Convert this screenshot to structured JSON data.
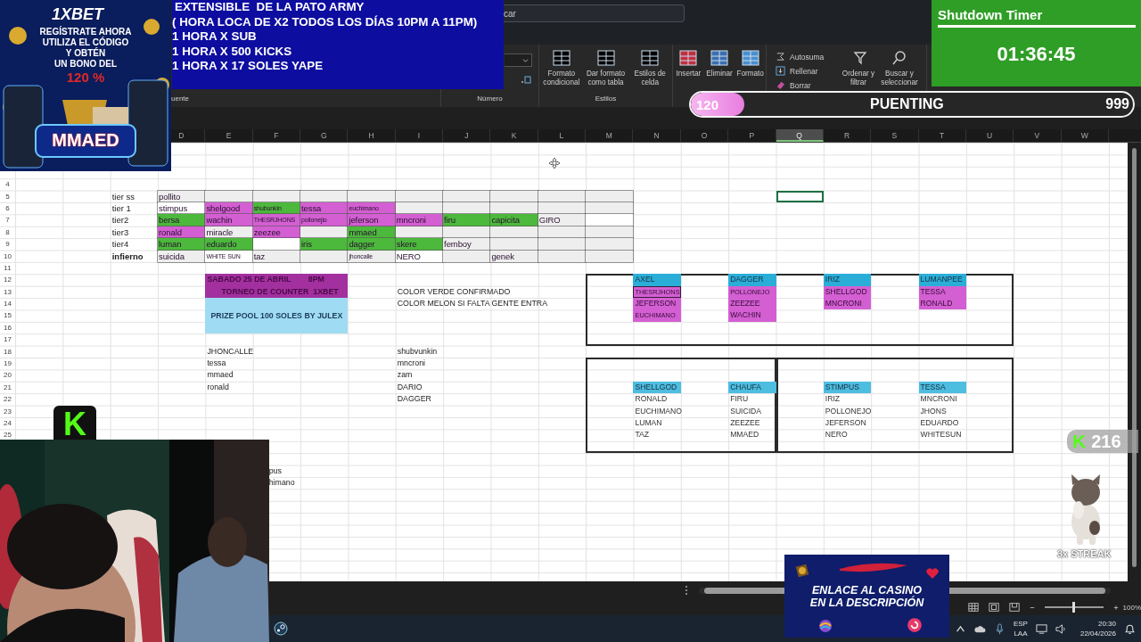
{
  "ad": {
    "brand": "1XBET",
    "lines": [
      "REGÍSTRATE AHORA",
      "UTILIZA EL CÓDIGO",
      "Y OBTÉN",
      "UN BONO DEL"
    ],
    "bonus": "120 %",
    "code": "MMAED"
  },
  "announcement": {
    "lines": [
      "EXTENSIBLE  DE LA PATO ARMY",
      "( HORA LOCA DE X2 TODOS LOS DÍAS 10PM A 11PM)",
      "1 HORA X SUB",
      "1 HORA X 500 KICKS",
      "1 HORA X 17 SOLES YAPE"
    ]
  },
  "timer": {
    "title": "Shutdown Timer",
    "time": "01:36:45"
  },
  "goal": {
    "current": "120",
    "label": "PUENTING",
    "target": "999",
    "level": 0.12
  },
  "search": {
    "placeholder": "car"
  },
  "groups": [
    {
      "kind": "label",
      "label": "uente"
    },
    {
      "kind": "number",
      "label": "Número"
    },
    {
      "kind": "buttons",
      "label": "Estilos",
      "buttons": [
        "Formato condicional",
        "Dar formato como tabla",
        "Estilos de celda"
      ]
    },
    {
      "kind": "buttons",
      "buttons": [
        "Insertar",
        "Eliminar",
        "Formato"
      ]
    },
    {
      "kind": "editing",
      "items": [
        "Autosuma",
        "Rellenar",
        "Borrar"
      ],
      "buttons": [
        "Ordenar y filtrar",
        "Buscar y seleccionar"
      ]
    }
  ],
  "sheet": {
    "columns": [
      {
        "label": "D",
        "selected": false
      },
      {
        "label": "E",
        "selected": false
      },
      {
        "label": "F",
        "selected": false
      },
      {
        "label": "G",
        "selected": false
      },
      {
        "label": "H",
        "selected": false
      },
      {
        "label": "I",
        "selected": false
      },
      {
        "label": "J",
        "selected": false
      },
      {
        "label": "K",
        "selected": false
      },
      {
        "label": "L",
        "selected": false
      },
      {
        "label": "M",
        "selected": false
      },
      {
        "label": "N",
        "selected": false
      },
      {
        "label": "O",
        "selected": false
      },
      {
        "label": "P",
        "selected": false
      },
      {
        "label": "Q",
        "selected": true
      },
      {
        "label": "R",
        "selected": false
      },
      {
        "label": "S",
        "selected": false
      },
      {
        "label": "T",
        "selected": false
      },
      {
        "label": "U",
        "selected": false
      },
      {
        "label": "V",
        "selected": false
      },
      {
        "label": "W",
        "selected": false
      }
    ],
    "row_numbers": [
      "4",
      "5",
      "6",
      "7",
      "8",
      "9",
      "10",
      "11",
      "12",
      "13",
      "14",
      "15",
      "16",
      "17",
      "18",
      "19",
      "20",
      "21",
      "22",
      "23",
      "24",
      "25"
    ],
    "tiers": [
      {
        "label": "tier ss",
        "bold": false,
        "cells": [
          {
            "text": "pollito",
            "color": "#eeeeee"
          },
          {
            "color": "#eeeeee"
          },
          {
            "color": "#eeeeee"
          },
          {
            "color": "#eeeeee"
          },
          {
            "color": "#eeeeee"
          },
          {
            "color": "#eeeeee"
          },
          {
            "color": "#eeeeee"
          },
          {
            "color": "#eeeeee"
          },
          {
            "color": "#eeeeee"
          },
          {
            "color": "#eeeeee"
          }
        ]
      },
      {
        "label": "tier 1",
        "bold": false,
        "cells": [
          {
            "text": "stimpus",
            "color": "#ffffff"
          },
          {
            "text": "shelgood",
            "color": "#d35fd2"
          },
          {
            "text": "shubunkin",
            "color": "#4cb83c"
          },
          {
            "text": "tessa",
            "color": "#d35fd2"
          },
          {
            "text": "euchimano",
            "color": "#d35fd2"
          },
          {
            "color": "#eeeeee"
          },
          {
            "color": "#eeeeee"
          },
          {
            "color": "#eeeeee"
          },
          {
            "color": "#eeeeee"
          },
          {
            "color": "#eeeeee"
          }
        ]
      },
      {
        "label": "tier2",
        "bold": false,
        "cells": [
          {
            "text": "bersa",
            "color": "#4cb83c"
          },
          {
            "text": "wachin",
            "color": "#d35fd2"
          },
          {
            "text": "THESRJHONS",
            "color": "#d35fd2"
          },
          {
            "text": "pollonejio",
            "color": "#d35fd2"
          },
          {
            "text": "jeferson",
            "color": "#d35fd2"
          },
          {
            "text": "mncroni",
            "color": "#d35fd2"
          },
          {
            "text": "firu",
            "color": "#4cb83c"
          },
          {
            "text": "capicita",
            "color": "#4cb83c"
          },
          {
            "text": "GIRO",
            "color": "#eeeeee"
          },
          {
            "color": "#ffffff"
          }
        ]
      },
      {
        "label": "tier3",
        "bold": false,
        "cells": [
          {
            "text": "ronald",
            "color": "#d35fd2"
          },
          {
            "text": "miracle",
            "color": "#eeeeee"
          },
          {
            "text": "zeezee",
            "color": "#d35fd2"
          },
          {
            "color": "#eeeeee"
          },
          {
            "text": "mmaed",
            "color": "#4cb83c"
          },
          {
            "color": "#eeeeee"
          },
          {
            "color": "#eeeeee"
          },
          {
            "color": "#eeeeee"
          },
          {
            "color": "#eeeeee"
          },
          {
            "color": "#eeeeee"
          }
        ]
      },
      {
        "label": "tier4",
        "bold": false,
        "cells": [
          {
            "text": "luman",
            "color": "#4cb83c"
          },
          {
            "text": "eduardo",
            "color": "#4cb83c"
          },
          {
            "color": "#ffffff"
          },
          {
            "text": "iris",
            "color": "#4cb83c"
          },
          {
            "text": "dagger",
            "color": "#4cb83c"
          },
          {
            "text": "skere",
            "color": "#4cb83c"
          },
          {
            "text": "femboy",
            "color": "#eeeeee"
          },
          {
            "color": "#eeeeee"
          },
          {
            "color": "#eeeeee"
          },
          {
            "color": "#eeeeee"
          }
        ]
      },
      {
        "label": "infierno",
        "bold": true,
        "cells": [
          {
            "text": "suicida",
            "color": "#eeeeee"
          },
          {
            "text": "WHITE SUN",
            "color": "#ffffff"
          },
          {
            "text": "taz",
            "color": "#eeeeee"
          },
          {
            "color": "#eeeeee"
          },
          {
            "text": "jhoncalle",
            "color": "#eeeeee"
          },
          {
            "text": "NERO",
            "color": "#ffffff"
          },
          {
            "color": "#eeeeee"
          },
          {
            "text": "genek",
            "color": "#eeeeee"
          },
          {
            "color": "#eeeeee"
          },
          {
            "color": "#eeeeee"
          }
        ]
      }
    ],
    "tournament": {
      "lines": [
        "SABADO 25 DE ABRIL        8PM",
        "TORNEO DE COUNTER  1XBET"
      ],
      "prize": "PRIZE POOL 100 SOLES BY JULEX"
    },
    "legend": [
      "COLOR VERDE CONFIRMADO",
      "COLOR MELON SI FALTA GENTE ENTRA"
    ],
    "list_left": [
      "JHONCALLE",
      "tessa",
      "mmaed",
      "ronald"
    ],
    "list_right": [
      "shubvunkin",
      "mncroni",
      "zam",
      "DARIO",
      "DAGGER"
    ],
    "list_cut": [
      "pus",
      "himano"
    ],
    "teams_top": [
      {
        "captain": "AXEL",
        "members": [
          {
            "name": "THESRJHONS",
            "outlined": true
          },
          {
            "name": "JEFERSON",
            "outlined": false
          },
          {
            "name": "EUCHIMANO",
            "outlined": false
          }
        ]
      },
      {
        "captain": "DAGGER",
        "members": [
          {
            "name": "POLLONEJO",
            "outlined": false
          },
          {
            "name": "ZEEZEE",
            "outlined": false
          },
          {
            "name": "WACHIN",
            "outlined": false
          }
        ]
      },
      {
        "captain": "IRIZ",
        "members": [
          {
            "name": "SHELLGOD",
            "outlined": false
          },
          {
            "name": "MNCRONI",
            "outlined": false
          }
        ]
      },
      {
        "captain": "LUMANPEE",
        "members": [
          {
            "name": "TESSA",
            "outlined": false
          },
          {
            "name": "RONALD",
            "outlined": false
          }
        ]
      }
    ],
    "teams_bottom": [
      {
        "captain": "SHELLGOD",
        "members": [
          "RONALD",
          "EUCHIMANO",
          "LUMAN",
          "TAZ"
        ]
      },
      {
        "captain": "CHAUFA",
        "members": [
          "FIRU",
          "SUICIDA",
          "ZEEZEE",
          "MMAED"
        ]
      },
      {
        "captain": "STIMPUS",
        "members": [
          "IRIZ",
          "POLLONEJO",
          "JEFERSON",
          "NERO"
        ]
      },
      {
        "captain": "TESSA",
        "members": [
          "MNCRONI",
          "JHONS",
          "EDUARDO",
          "WHITESUN"
        ]
      }
    ]
  },
  "kick": {
    "logo": "K",
    "badge_logo": "K",
    "count": "216",
    "streak": "3x STREAK"
  },
  "casino": {
    "lines": [
      "ENLACE AL CASINO",
      "EN LA DESCRIPCIÓN"
    ]
  },
  "zoom": {
    "level": 0.5,
    "reading": "100%"
  },
  "taskbar": {
    "language": [
      "ESP",
      "LAA"
    ],
    "time": "20:30",
    "date": "22/04/2026"
  }
}
